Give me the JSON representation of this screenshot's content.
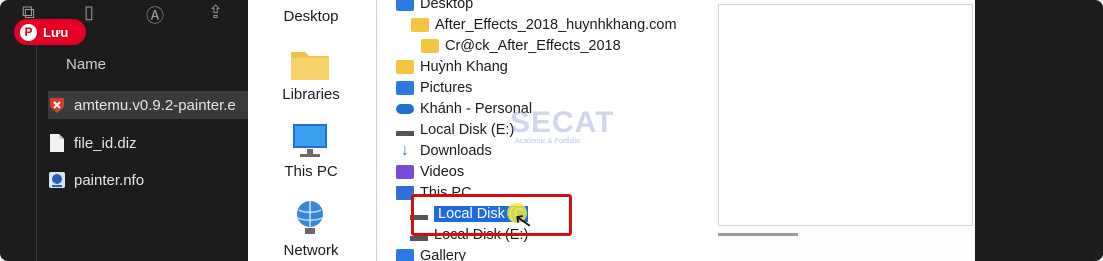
{
  "pin_button": {
    "label": "Lưu"
  },
  "explorer": {
    "column_header": "Name",
    "files": [
      {
        "name": "amtemu.v0.9.2-painter.e",
        "icon": "amtemu-icon",
        "selected": true
      },
      {
        "name": "file_id.diz",
        "icon": "file-icon",
        "selected": false
      },
      {
        "name": "painter.nfo",
        "icon": "nfo-icon",
        "selected": false
      }
    ]
  },
  "dialog": {
    "quick_access": [
      {
        "label": "Desktop",
        "icon": "desktop-icon"
      },
      {
        "label": "Libraries",
        "icon": "libraries-icon"
      },
      {
        "label": "This PC",
        "icon": "this-pc-icon"
      },
      {
        "label": "Network",
        "icon": "network-icon"
      }
    ],
    "tree": [
      {
        "label": "Desktop",
        "icon": "desktop-icon"
      },
      {
        "label": "After_Effects_2018_huynhkhang.com",
        "icon": "folder-icon"
      },
      {
        "label": "Cr@ck_After_Effects_2018",
        "icon": "folder-icon"
      },
      {
        "label": "Huỳnh Khang",
        "icon": "folder-icon"
      },
      {
        "label": "Pictures",
        "icon": "pictures-icon"
      },
      {
        "label": "Khánh - Personal",
        "icon": "onedrive-icon"
      },
      {
        "label": "Local Disk (E:)",
        "icon": "disk-icon"
      },
      {
        "label": "Downloads",
        "icon": "downloads-icon"
      },
      {
        "label": "Videos",
        "icon": "videos-icon"
      },
      {
        "label": "This PC",
        "icon": "this-pc-icon"
      },
      {
        "label": "Local Disk (C",
        "icon": "disk-icon",
        "selected": true
      },
      {
        "label": "Local Disk (E:)",
        "icon": "disk-icon"
      },
      {
        "label": "Gallery",
        "icon": "gallery-icon"
      }
    ]
  },
  "watermark": {
    "text": "SECAT",
    "subtext": "Academic & Portfolio"
  },
  "colors": {
    "pin_red": "#e60023",
    "selection_blue": "#1e6be0",
    "highlight_red": "#d40d12",
    "dark_bg": "#1c1c1c"
  }
}
